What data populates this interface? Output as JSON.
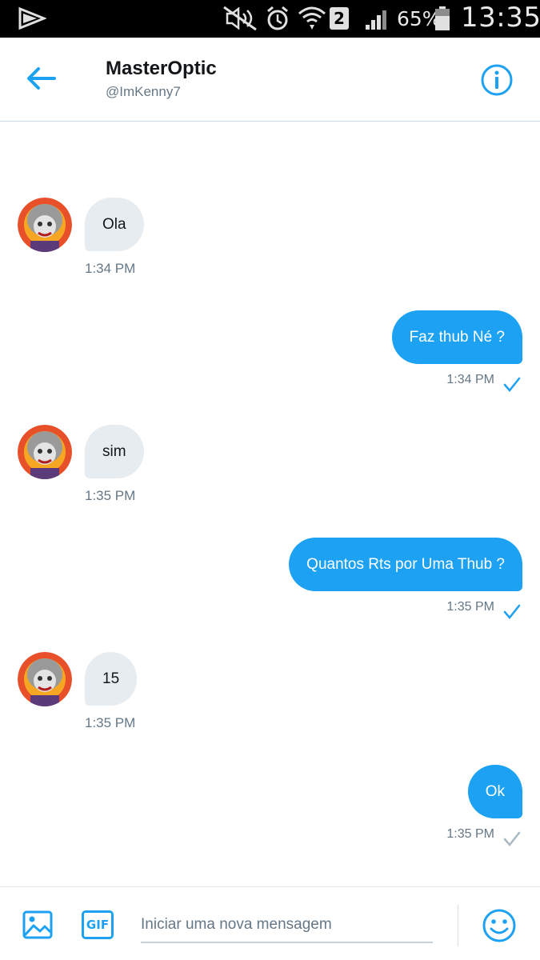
{
  "status_bar": {
    "battery_percent": "65%",
    "sim_slot": "2",
    "time": "13:35",
    "icons": [
      "play-icon",
      "mute-icon",
      "alarm-icon",
      "wifi-icon",
      "sim-icon",
      "signal-icon",
      "battery-icon"
    ]
  },
  "header": {
    "title": "MasterOptic",
    "handle": "@ImKenny7",
    "back_icon": "arrow-left-icon",
    "info_icon": "info-icon"
  },
  "messages": [
    {
      "direction": "in",
      "text": "Ola",
      "time": "1:34 PM"
    },
    {
      "direction": "out",
      "text": "Faz thub Né ?",
      "time": "1:34 PM",
      "status": "read"
    },
    {
      "direction": "in",
      "text": "sim",
      "time": "1:35 PM"
    },
    {
      "direction": "out",
      "text": "Quantos Rts por Uma Thub ?",
      "time": "1:35 PM",
      "status": "read"
    },
    {
      "direction": "in",
      "text": "15",
      "time": "1:35 PM"
    },
    {
      "direction": "out",
      "text": "Ok",
      "time": "1:35 PM",
      "status": "sent"
    }
  ],
  "composer": {
    "placeholder": "Iniciar uma nova mensagem",
    "value": "",
    "gif_label": "GIF",
    "image_icon": "image-icon",
    "emoji_icon": "emoji-icon"
  },
  "colors": {
    "accent": "#1da1f2",
    "incoming_bubble": "#e6ecf0",
    "secondary_text": "#657786",
    "sent_check": "#aab8c2"
  }
}
